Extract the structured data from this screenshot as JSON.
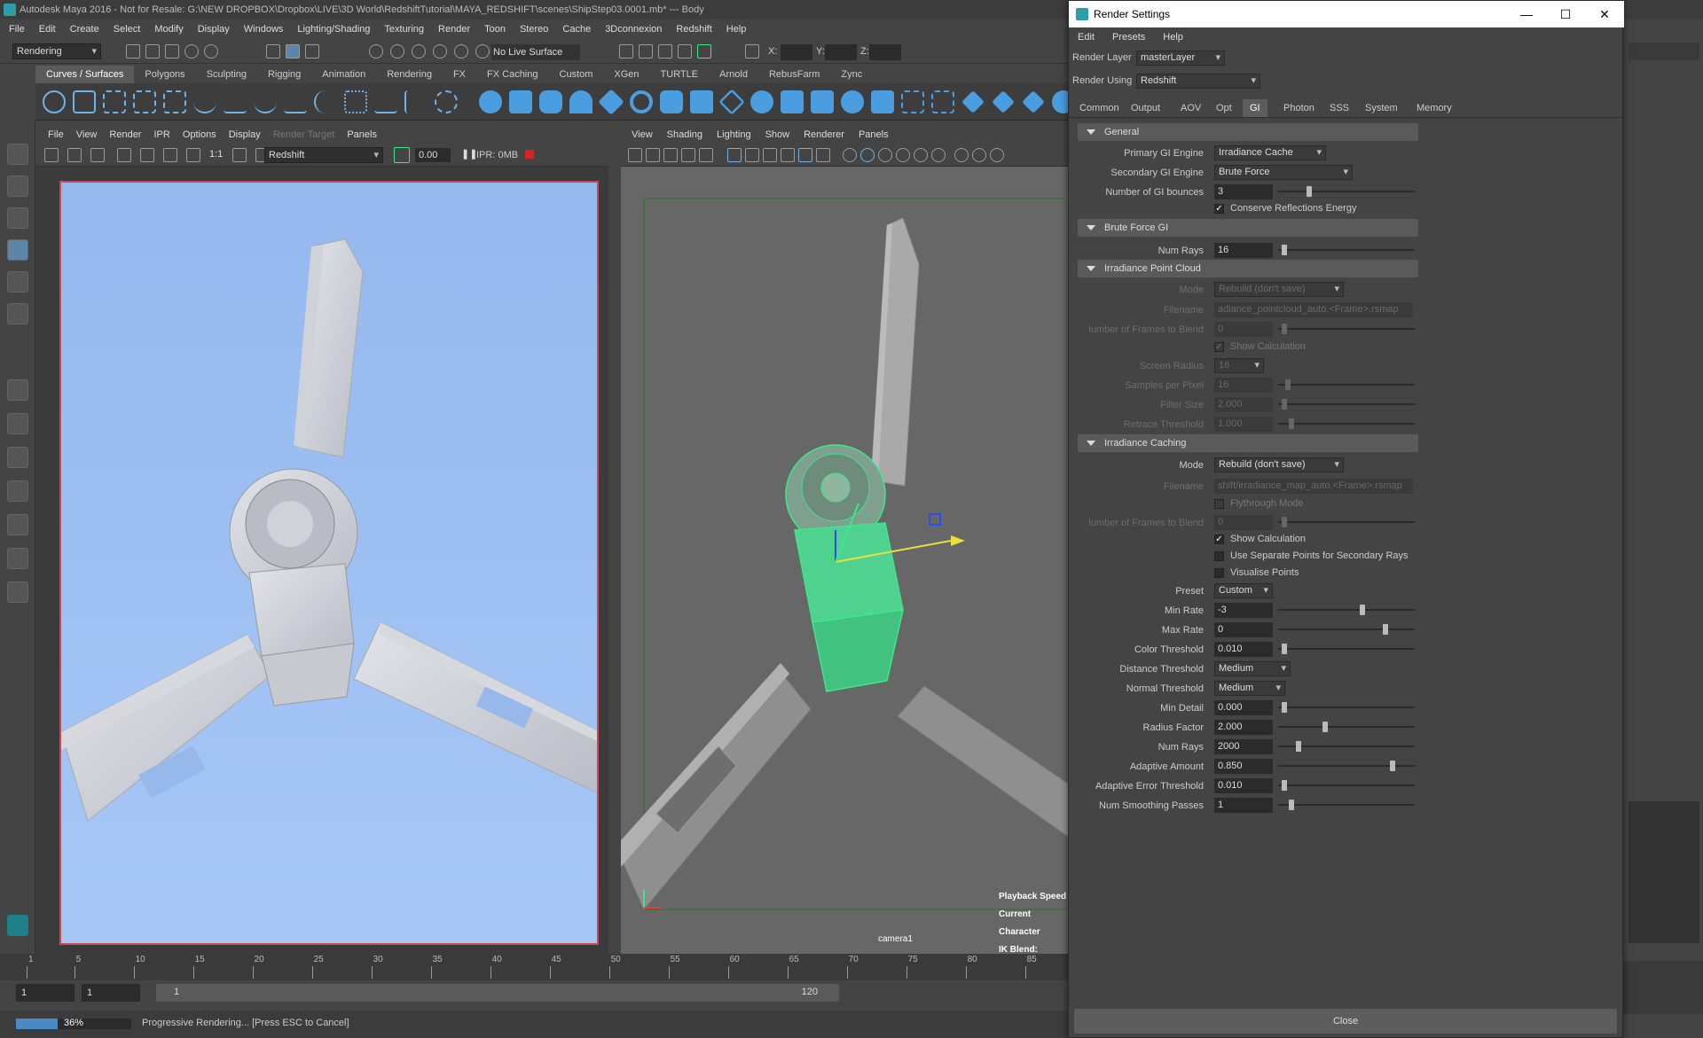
{
  "window": {
    "title": "Autodesk Maya 2016 - Not for Resale: G:\\NEW DROPBOX\\Dropbox\\LIVE\\3D World\\RedshiftTutorial\\MAYA_REDSHIFT\\scenes\\ShipStep03.0001.mb*  ---  Body"
  },
  "menu": [
    "File",
    "Edit",
    "Create",
    "Select",
    "Modify",
    "Display",
    "Windows",
    "Lighting/Shading",
    "Texturing",
    "Render",
    "Toon",
    "Stereo",
    "Cache",
    "3Dconnexion",
    "Redshift",
    "Help"
  ],
  "statusline": {
    "mode": "Rendering",
    "live_surface": "No Live Surface",
    "x_label": "X:",
    "y_label": "Y:",
    "z_label": "Z:"
  },
  "shelf_tabs": [
    "Curves / Surfaces",
    "Polygons",
    "Sculpting",
    "Rigging",
    "Animation",
    "Rendering",
    "FX",
    "FX Caching",
    "Custom",
    "XGen",
    "TURTLE",
    "Arnold",
    "RebusFarm",
    "Zync"
  ],
  "render_view": {
    "menu": [
      "File",
      "View",
      "Render",
      "IPR",
      "Options",
      "Display",
      "Render Target",
      "Panels"
    ],
    "ratio": "1:1",
    "renderer": "Redshift",
    "time": "0.00",
    "ipr_mem": "IPR: 0MB"
  },
  "viewport": {
    "menu": [
      "View",
      "Shading",
      "Lighting",
      "Show",
      "Renderer",
      "Panels"
    ],
    "hud": {
      "playback": "Playback Speed",
      "character": "Current Character",
      "ik": "IK Blend:"
    },
    "camera": "camera1"
  },
  "timeline": {
    "ticks": [
      "1",
      "5",
      "10",
      "15",
      "20",
      "25",
      "30",
      "35",
      "40",
      "45",
      "50",
      "55",
      "60",
      "65",
      "70",
      "75",
      "80",
      "85"
    ]
  },
  "range": {
    "start": "1",
    "current": "1",
    "anim_start": "1",
    "end": "120"
  },
  "help": {
    "progress_percent": 36,
    "progress_text": "36%",
    "message": "Progressive Rendering... [Press ESC to Cancel]"
  },
  "dialog": {
    "title": "Render Settings",
    "menu": [
      "Edit",
      "Presets",
      "Help"
    ],
    "render_layer_label": "Render Layer",
    "render_layer": "masterLayer",
    "render_using_label": "Render Using",
    "render_using": "Redshift",
    "tabs": [
      "Common",
      "Output",
      "AOV",
      "Opt",
      "GI",
      "Photon",
      "SSS",
      "System",
      "Memory"
    ],
    "active_tab": "GI",
    "general": {
      "title": "General",
      "primary_label": "Primary GI Engine",
      "primary": "Irradiance Cache",
      "secondary_label": "Secondary GI Engine",
      "secondary": "Brute Force",
      "bounces_label": "Number of GI bounces",
      "bounces": "3",
      "conserve_label": "Conserve Reflections Energy"
    },
    "brute": {
      "title": "Brute Force GI",
      "rays_label": "Num Rays",
      "rays": "16"
    },
    "ipc": {
      "title": "Irradiance Point Cloud",
      "mode_label": "Mode",
      "mode": "Rebuild (don't save)",
      "filename_label": "Filename",
      "filename": "adiance_pointcloud_auto.<Frame>.rsmap",
      "frames_label": "lumber of Frames to Blend",
      "frames": "0",
      "show_calc_label": "Show Calculation",
      "screen_radius_label": "Screen Radius",
      "screen_radius": "16",
      "spp_label": "Samples per Pixel",
      "spp": "16",
      "filter_label": "Filter Size",
      "filter": "2.000",
      "retrace_label": "Retrace Threshold",
      "retrace": "1.000"
    },
    "ic": {
      "title": "Irradiance Caching",
      "mode_label": "Mode",
      "mode": "Rebuild (don't save)",
      "filename_label": "Filename",
      "filename": "shift/irradiance_map_auto.<Frame>.rsmap",
      "flythrough_label": "Flythrough Mode",
      "frames_label": "lumber of Frames to Blend",
      "frames": "0",
      "show_calc_label": "Show Calculation",
      "separate_label": "Use Separate Points for Secondary Rays",
      "visualise_label": "Visualise Points",
      "preset_label": "Preset",
      "preset": "Custom",
      "min_rate_label": "Min Rate",
      "min_rate": "-3",
      "max_rate_label": "Max Rate",
      "max_rate": "0",
      "color_thr_label": "Color Threshold",
      "color_thr": "0.010",
      "dist_thr_label": "Distance Threshold",
      "dist_thr": "Medium",
      "normal_thr_label": "Normal Threshold",
      "normal_thr": "Medium",
      "min_detail_label": "Min Detail",
      "min_detail": "0.000",
      "radius_label": "Radius Factor",
      "radius": "2.000",
      "rays_label": "Num Rays",
      "rays": "2000",
      "adaptive_label": "Adaptive Amount",
      "adaptive": "0.850",
      "adaptive_err_label": "Adaptive Error Threshold",
      "adaptive_err": "0.010",
      "smooth_label": "Num Smoothing Passes",
      "smooth": "1"
    },
    "close": "Close"
  },
  "colors": {
    "accent": "#2b9ea8",
    "selection": "#3de88a",
    "render_bg": "#9dc0f2"
  }
}
